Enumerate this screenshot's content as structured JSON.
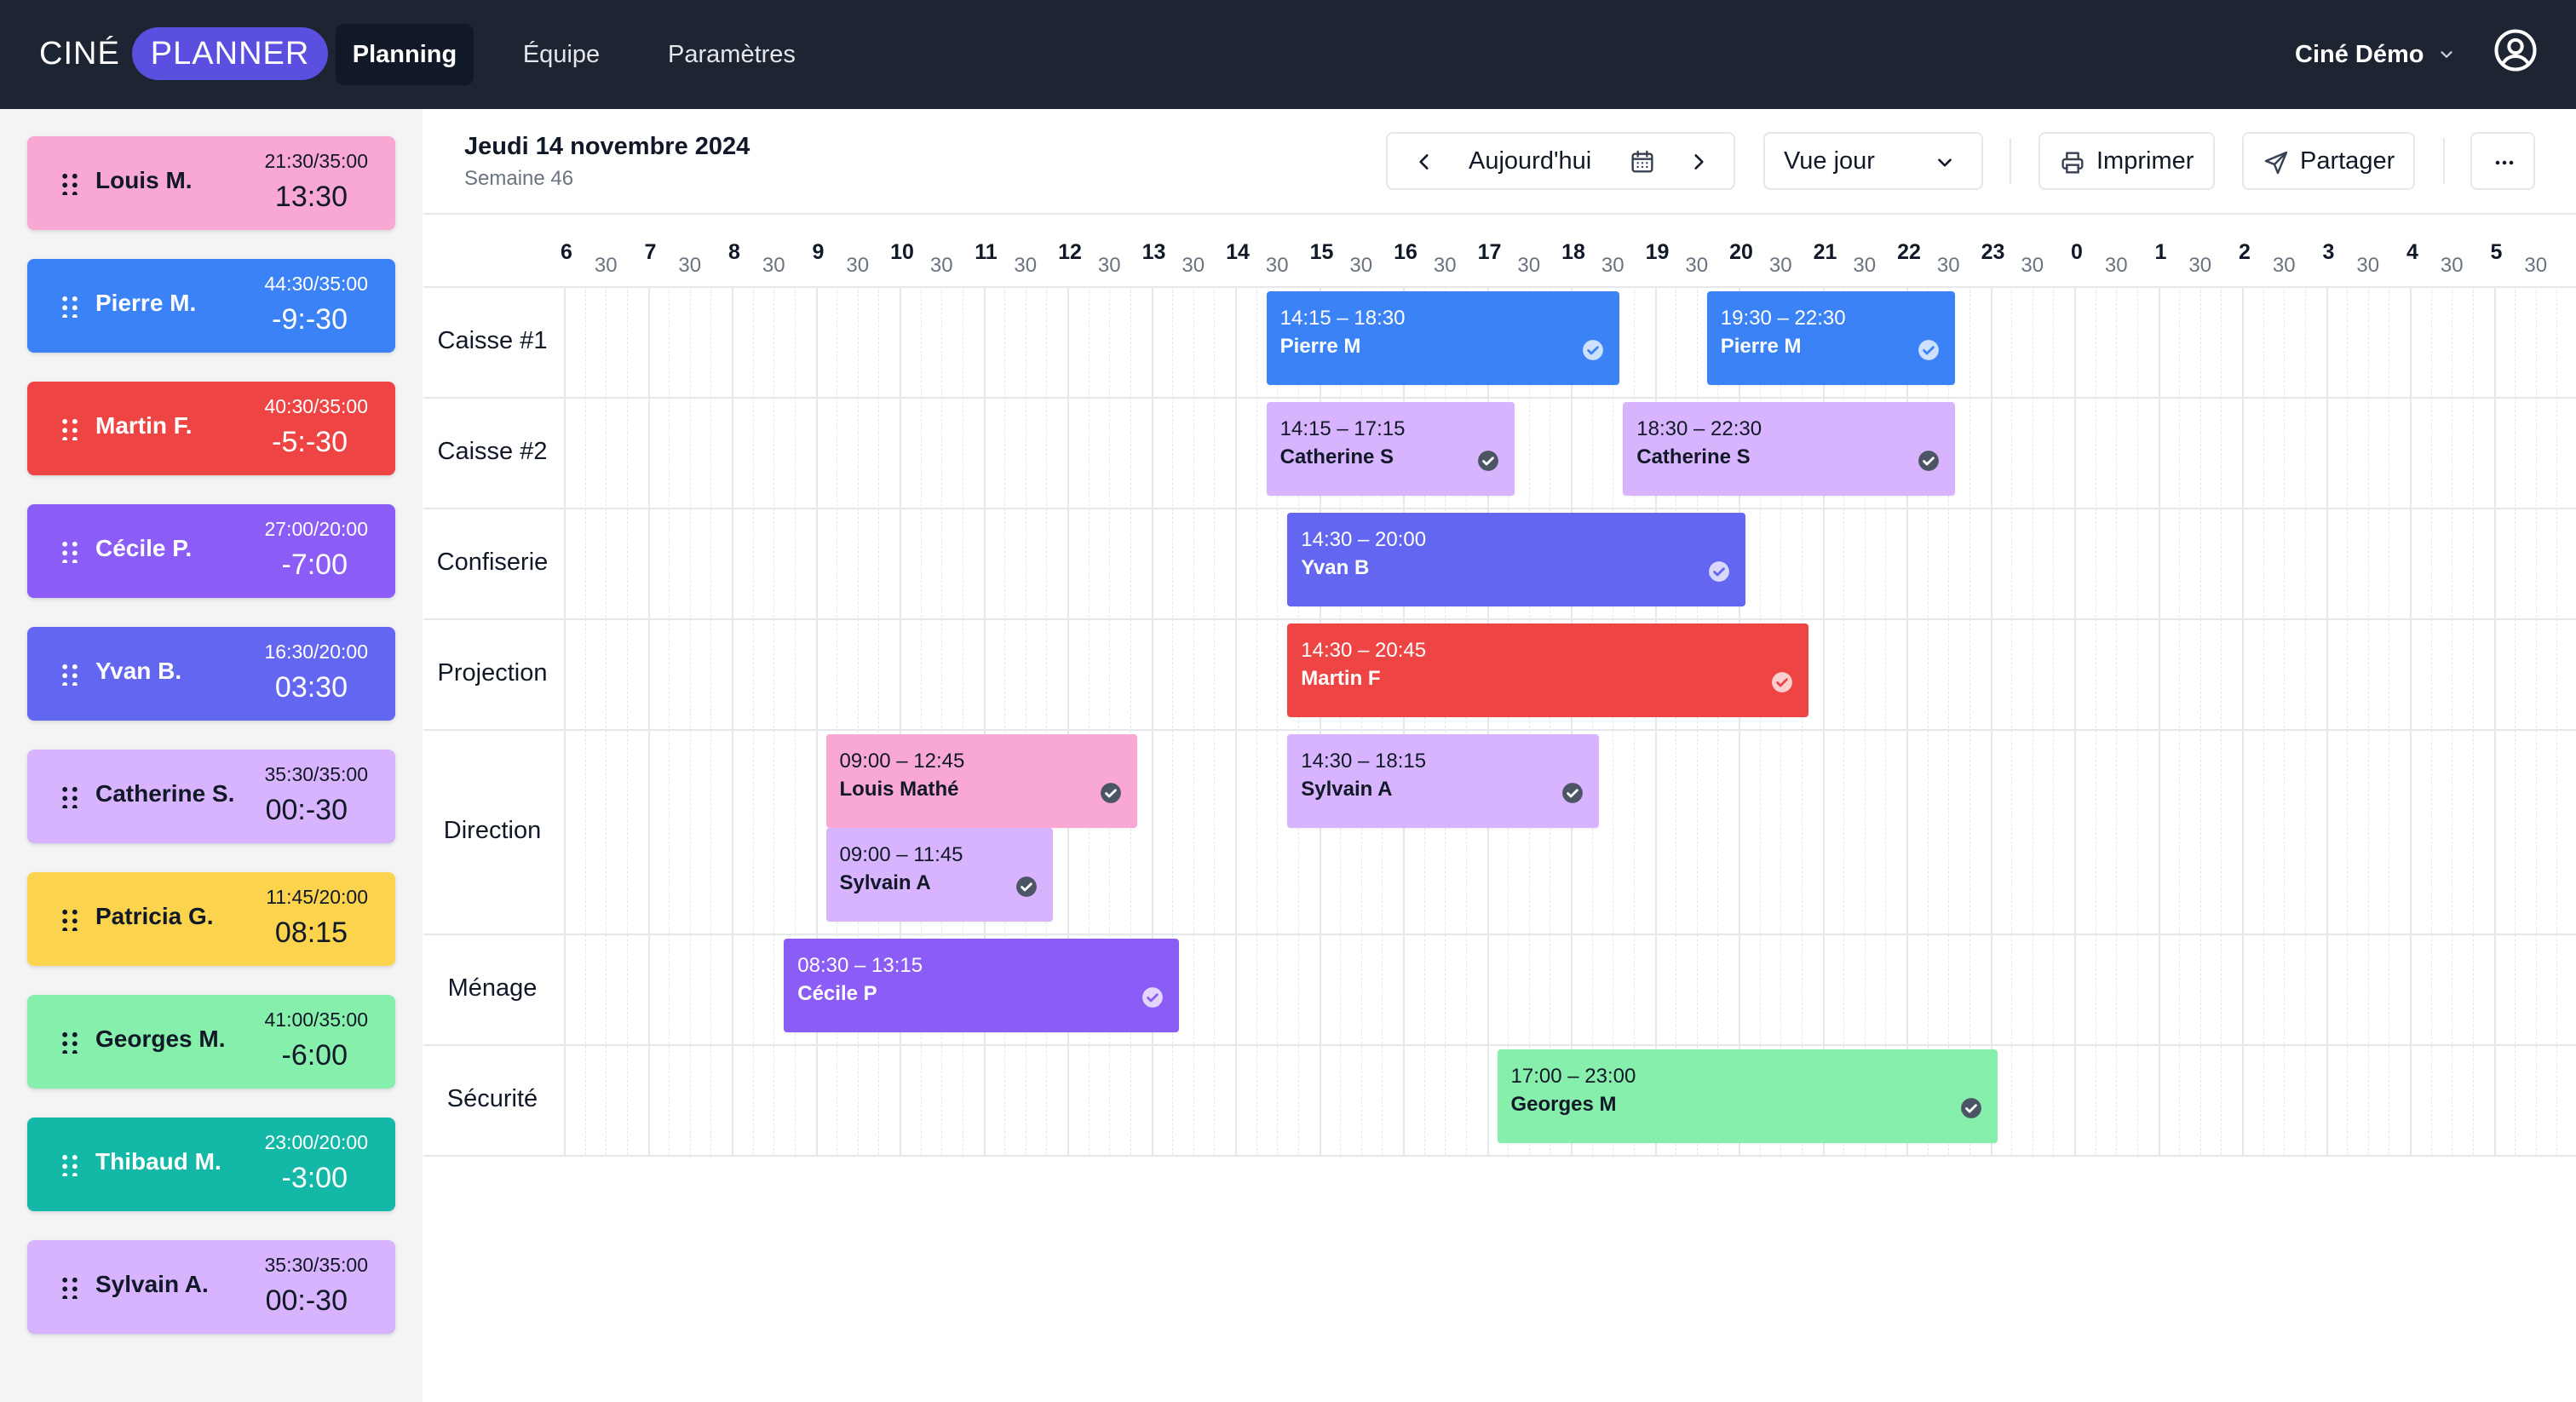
{
  "app": {
    "logo_part1": "CINÉ",
    "logo_part2": "PLANNER",
    "nav": [
      "Planning",
      "Équipe",
      "Paramètres"
    ],
    "active_tab": "Planning",
    "account_name": "Ciné Démo"
  },
  "header": {
    "date": "Jeudi 14 novembre 2024",
    "week": "Semaine 46",
    "today_label": "Aujourd'hui",
    "view_label": "Vue jour",
    "print_label": "Imprimer",
    "share_label": "Partager"
  },
  "colors": {
    "pink": "#f9a8d4",
    "blue": "#3b82f6",
    "red": "#ef4444",
    "violet": "#8b5cf6",
    "indigo": "#6366f1",
    "lavender": "#d8b4fe",
    "yellow": "#fcd34d",
    "green": "#86efac",
    "teal": "#14b8a6",
    "nav_bg": "#1e2532",
    "logo_accent": "#5b4fe0"
  },
  "employees": [
    {
      "name": "Louis M.",
      "hours": "21:30/35:00",
      "balance": "13:30",
      "color": "pink",
      "text": "dark"
    },
    {
      "name": "Pierre M.",
      "hours": "44:30/35:00",
      "balance": "-9:-30",
      "color": "blue",
      "text": "light"
    },
    {
      "name": "Martin F.",
      "hours": "40:30/35:00",
      "balance": "-5:-30",
      "color": "red",
      "text": "light"
    },
    {
      "name": "Cécile P.",
      "hours": "27:00/20:00",
      "balance": "-7:00",
      "color": "violet",
      "text": "light"
    },
    {
      "name": "Yvan B.",
      "hours": "16:30/20:00",
      "balance": "03:30",
      "color": "indigo",
      "text": "light"
    },
    {
      "name": "Catherine S.",
      "hours": "35:30/35:00",
      "balance": "00:-30",
      "color": "lavender",
      "text": "dark"
    },
    {
      "name": "Patricia G.",
      "hours": "11:45/20:00",
      "balance": "08:15",
      "color": "yellow",
      "text": "dark"
    },
    {
      "name": "Georges M.",
      "hours": "41:00/35:00",
      "balance": "-6:00",
      "color": "green",
      "text": "dark"
    },
    {
      "name": "Thibaud M.",
      "hours": "23:00/20:00",
      "balance": "-3:00",
      "color": "teal",
      "text": "light"
    },
    {
      "name": "Sylvain A.",
      "hours": "35:30/35:00",
      "balance": "00:-30",
      "color": "lavender",
      "text": "dark"
    }
  ],
  "timeline": {
    "hours": [
      "6",
      "7",
      "8",
      "9",
      "10",
      "11",
      "12",
      "13",
      "14",
      "15",
      "16",
      "17",
      "18",
      "19",
      "20",
      "21",
      "22",
      "23",
      "0",
      "1",
      "2",
      "3",
      "4",
      "5"
    ],
    "half_label": "30"
  },
  "posts": [
    {
      "name": "Caisse #1",
      "lanes": 1
    },
    {
      "name": "Caisse #2",
      "lanes": 1
    },
    {
      "name": "Confiserie",
      "lanes": 1
    },
    {
      "name": "Projection",
      "lanes": 1
    },
    {
      "name": "Direction",
      "lanes": 2
    },
    {
      "name": "Ménage",
      "lanes": 1
    },
    {
      "name": "Sécurité",
      "lanes": 1
    }
  ],
  "shifts": [
    {
      "post": 0,
      "lane": 0,
      "start": "14:15",
      "end": "18:30",
      "time": "14:15 – 18:30",
      "who": "Pierre M",
      "color": "blue",
      "text": "light"
    },
    {
      "post": 0,
      "lane": 0,
      "start": "19:30",
      "end": "22:30",
      "time": "19:30 – 22:30",
      "who": "Pierre M",
      "color": "blue",
      "text": "light"
    },
    {
      "post": 1,
      "lane": 0,
      "start": "14:15",
      "end": "17:15",
      "time": "14:15 – 17:15",
      "who": "Catherine S",
      "color": "lavender",
      "text": "dark"
    },
    {
      "post": 1,
      "lane": 0,
      "start": "18:30",
      "end": "22:30",
      "time": "18:30 – 22:30",
      "who": "Catherine S",
      "color": "lavender",
      "text": "dark"
    },
    {
      "post": 2,
      "lane": 0,
      "start": "14:30",
      "end": "20:00",
      "time": "14:30 – 20:00",
      "who": "Yvan B",
      "color": "indigo",
      "text": "light"
    },
    {
      "post": 3,
      "lane": 0,
      "start": "14:30",
      "end": "20:45",
      "time": "14:30 – 20:45",
      "who": "Martin F",
      "color": "red",
      "text": "light"
    },
    {
      "post": 4,
      "lane": 0,
      "start": "09:00",
      "end": "12:45",
      "time": "09:00 – 12:45",
      "who": "Louis Mathé",
      "color": "pink",
      "text": "dark"
    },
    {
      "post": 4,
      "lane": 0,
      "start": "14:30",
      "end": "18:15",
      "time": "14:30 – 18:15",
      "who": "Sylvain A",
      "color": "lavender",
      "text": "dark"
    },
    {
      "post": 4,
      "lane": 1,
      "start": "09:00",
      "end": "11:45",
      "time": "09:00 – 11:45",
      "who": "Sylvain A",
      "color": "lavender",
      "text": "dark"
    },
    {
      "post": 5,
      "lane": 0,
      "start": "08:30",
      "end": "13:15",
      "time": "08:30 – 13:15",
      "who": "Cécile P",
      "color": "violet",
      "text": "light"
    },
    {
      "post": 6,
      "lane": 0,
      "start": "17:00",
      "end": "23:00",
      "time": "17:00 – 23:00",
      "who": "Georges M",
      "color": "green",
      "text": "dark"
    }
  ]
}
